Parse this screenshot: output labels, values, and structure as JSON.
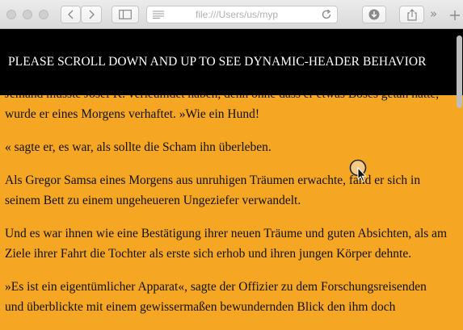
{
  "browser": {
    "address": "file:///Users/us/myp",
    "icons": [
      "back-icon",
      "forward-icon",
      "sidebar-icon",
      "reader-lines-icon",
      "reload-icon",
      "downloads-icon",
      "share-icon",
      "overflow-chevrons-icon",
      "new-tab-icon"
    ]
  },
  "header": {
    "title": "PLEASE SCROLL DOWN AND UP TO SEE DYNAMIC-HEADER BEHAVIOR"
  },
  "article": {
    "paragraphs": [
      "Jemand musste Josef K. verleumdet haben, denn ohne dass er etwas Böses getan hätte, wurde er eines Morgens verhaftet. »Wie ein Hund!",
      "« sagte er, es war, als sollte die Scham ihn überleben.",
      "Als Gregor Samsa eines Morgens aus unruhigen Träumen erwachte, fand er sich in seinem Bett zu einem ungeheueren Ungeziefer verwandelt.",
      "Und es war ihnen wie eine Bestätigung ihrer neuen Träume und guten Absichten, als am Ziele ihrer Fahrt die Tochter als erste sich erhob und ihren jungen Körper dehnte.",
      "»Es ist ein eigentümlicher Apparat«, sagte der Offizier zu dem Forschungsreisenden und überblickte mit einem gewissermaßen bewundernden Blick den ihm doch"
    ]
  },
  "colors": {
    "page_background": "#f5a623",
    "header_background": "#000000",
    "header_text": "#ffffff"
  }
}
